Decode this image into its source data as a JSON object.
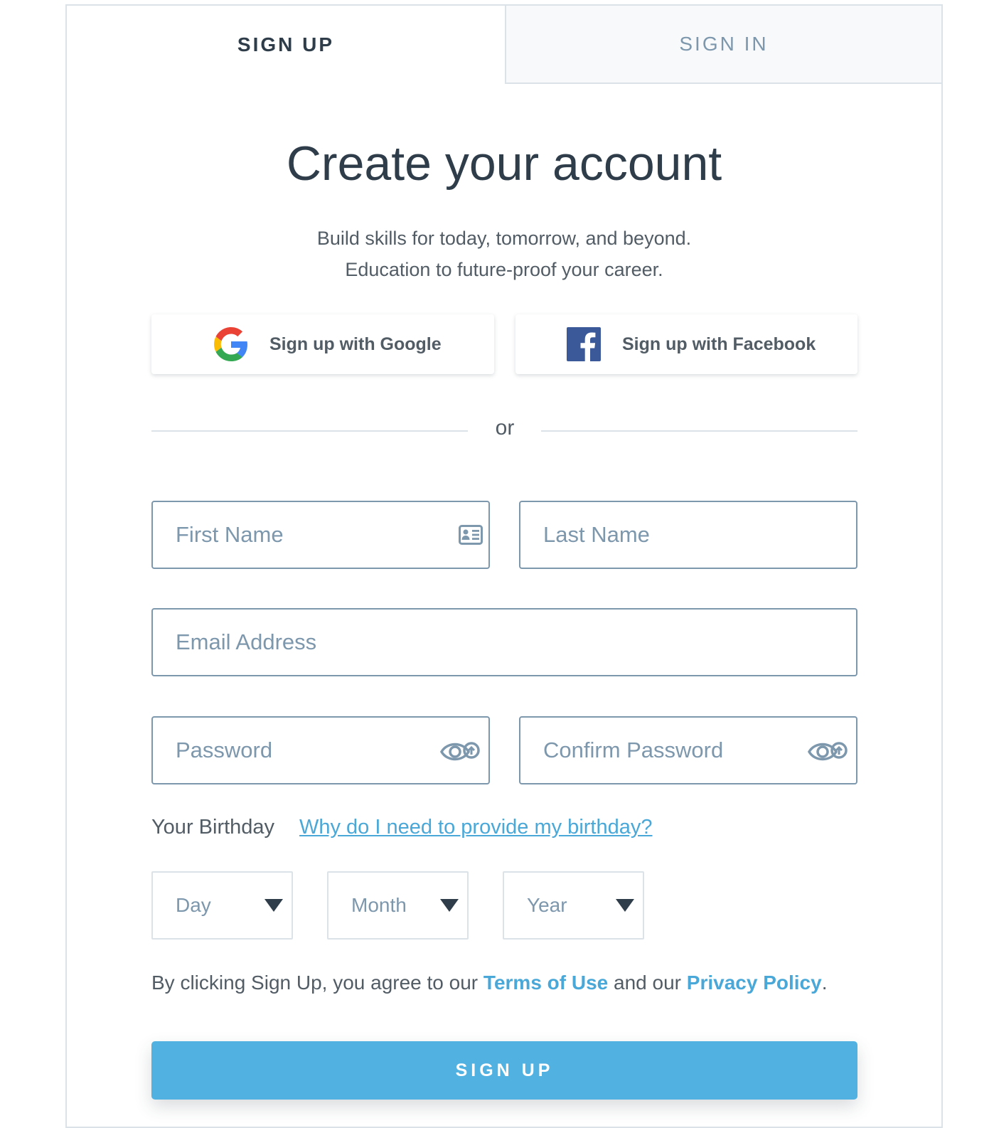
{
  "tabs": {
    "signup": "SIGN UP",
    "signin": "SIGN IN"
  },
  "heading": {
    "title": "Create your account",
    "subtitle_line1": "Build skills for today, tomorrow, and beyond.",
    "subtitle_line2": "Education to future-proof your career."
  },
  "social": {
    "google_label": "Sign up with Google",
    "google_icon": "google-logo-icon",
    "facebook_label": "Sign up with Facebook",
    "facebook_icon": "facebook-logo-icon"
  },
  "divider": {
    "text": "or"
  },
  "form": {
    "first_name_placeholder": "First Name",
    "first_name_value": "",
    "last_name_placeholder": "Last Name",
    "last_name_value": "",
    "email_placeholder": "Email Address",
    "email_value": "",
    "password_placeholder": "Password",
    "password_value": "",
    "confirm_password_placeholder": "Confirm Password",
    "confirm_password_value": ""
  },
  "birthday": {
    "label": "Your Birthday",
    "help_link": "Why do I need to provide my birthday?",
    "day": "Day",
    "month": "Month",
    "year": "Year"
  },
  "terms": {
    "prefix": "By clicking Sign Up, you agree to our ",
    "terms_link": "Terms of Use",
    "middle": " and our ",
    "privacy_link": "Privacy Policy",
    "suffix": "."
  },
  "submit": {
    "label": "SIGN UP"
  },
  "colors": {
    "accent": "#51b1e0",
    "link": "#4aa8d8",
    "text_dark": "#2e3d49",
    "placeholder": "#7d97ad",
    "border": "#dbe2e8",
    "facebook": "#3b5998"
  }
}
